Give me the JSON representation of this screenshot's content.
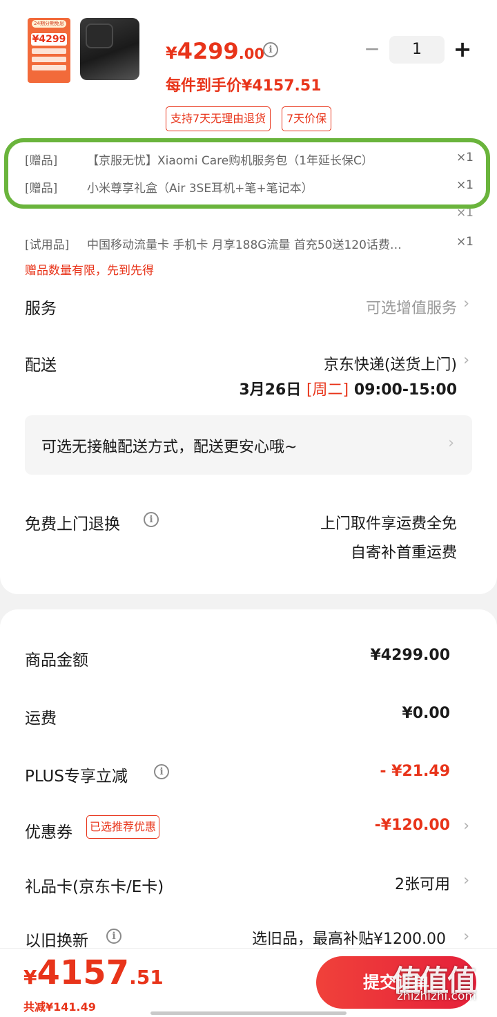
{
  "product": {
    "promo_thumb": {
      "header": "24期分期免息",
      "price": "¥4299"
    },
    "price_symbol": "¥",
    "price_int": "4299",
    "price_dec": ".00",
    "hand_price": "每件到手价¥4157.51",
    "quantity": "1",
    "tags": [
      "支持7天无理由退货",
      "7天价保"
    ]
  },
  "gifts": [
    {
      "prefix": "[赠品]",
      "name": "【京服无忧】Xiaomi Care购机服务包（1年延长保C）",
      "qty": "×1"
    },
    {
      "prefix": "[赠品]",
      "name": "小米尊享礼盒（Air 3SE耳机+笔+笔记本）",
      "qty": "×1"
    },
    {
      "prefix": "[试用品]",
      "name": "中国移动流量卡 手机卡 月享188G流量 首充50送120话费…",
      "qty": "×1"
    }
  ],
  "gift_notice": "赠品数量有限，先到先得",
  "service": {
    "label": "服务",
    "value": "可选增值服务"
  },
  "delivery": {
    "label": "配送",
    "method": "京东快递(送货上门)",
    "date": "3月26日",
    "weekday": "[周二]",
    "time": "09:00-15:00"
  },
  "contactless": "可选无接触配送方式，配送更安心哦~",
  "returns": {
    "label": "免费上门退换",
    "line1": "上门取件享运费全免",
    "line2": "自寄补首重运费"
  },
  "summary": {
    "goods_label": "商品金额",
    "goods_value": "¥4299.00",
    "shipping_label": "运费",
    "shipping_value": "¥0.00",
    "plus_label": "PLUS专享立减",
    "plus_value": "- ¥21.49",
    "coupon_label": "优惠券",
    "coupon_tag": "已选推荐优惠",
    "coupon_value": "-¥120.00",
    "giftcard_label": "礼品卡(京东卡/E卡)",
    "giftcard_value": "2张可用",
    "tradein_label": "以旧换新",
    "tradein_value": "选旧品，最高补贴¥1200.00"
  },
  "footer": {
    "pay_symbol": "¥",
    "pay_int": "4157",
    "pay_dec": ".51",
    "saved": "共减¥141.49",
    "submit": "提交订单",
    "watermark": "值值值",
    "watermark_url": "zhizhizhi.com"
  },
  "colors": {
    "accent": "#e8341a",
    "highlight": "#6ab43c"
  }
}
